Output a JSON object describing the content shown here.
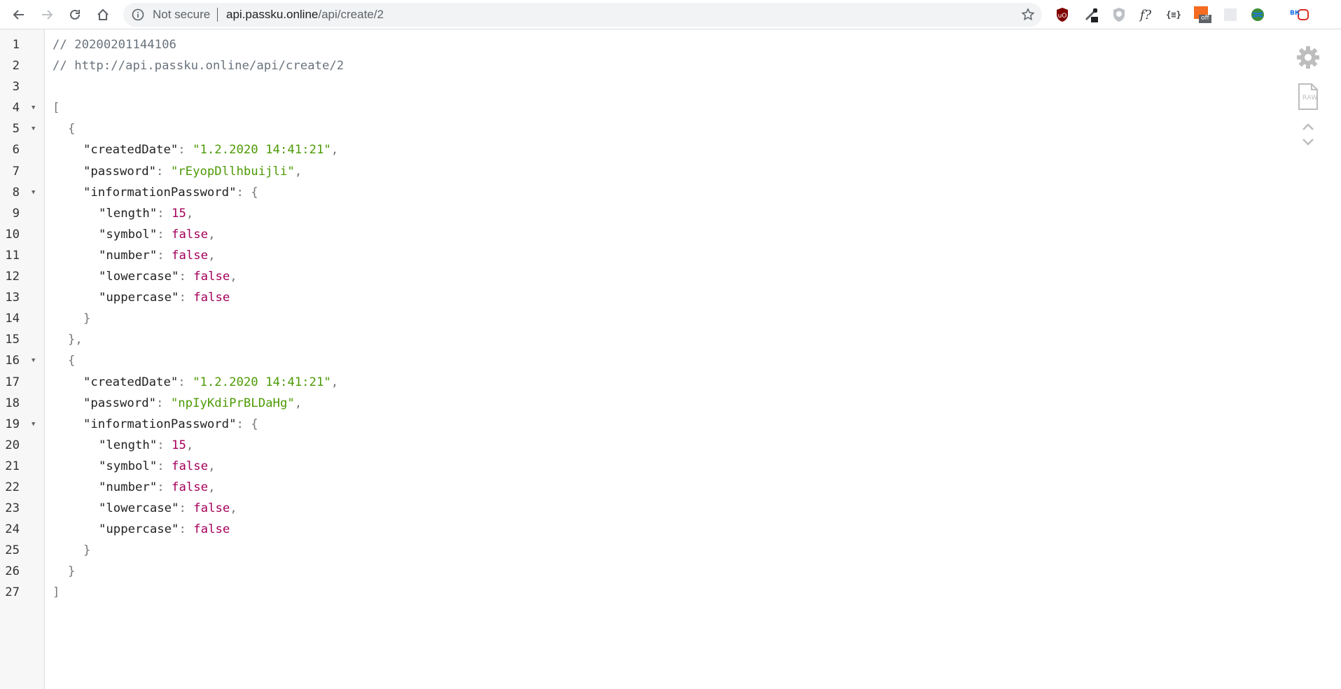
{
  "browser": {
    "security_label": "Not secure",
    "url_host": "api.passku.online",
    "url_path": "/api/create/2",
    "extensions": [
      {
        "name": "ublock-icon",
        "color": "#800000"
      },
      {
        "name": "eyedropper-icon",
        "color": "#202124"
      },
      {
        "name": "shield-icon",
        "color": "#9aa0a6"
      },
      {
        "name": "font-finder-icon",
        "label": "f?"
      },
      {
        "name": "json-viewer-icon",
        "label": "{≡}"
      },
      {
        "name": "off-extension-icon",
        "badge": "off",
        "color": "#f36c21"
      },
      {
        "name": "blank-extension-icon",
        "color": "#e8eaed"
      },
      {
        "name": "globe-extension-icon",
        "color": "#3b8e3a"
      },
      {
        "name": "vk-extension-icon",
        "label": "ВК"
      }
    ]
  },
  "json_view": {
    "header_comments": [
      "// 20200201144106",
      "// http://api.passku.online/api/create/2"
    ],
    "lines": [
      {
        "n": "1",
        "fold": false,
        "indent": 0,
        "tokens": [
          {
            "t": "comment",
            "v": "// 20200201144106"
          }
        ]
      },
      {
        "n": "2",
        "fold": false,
        "indent": 0,
        "tokens": [
          {
            "t": "comment",
            "v": "// http://api.passku.online/api/create/2"
          }
        ]
      },
      {
        "n": "3",
        "fold": false,
        "indent": 0,
        "tokens": []
      },
      {
        "n": "4",
        "fold": true,
        "indent": 0,
        "tokens": [
          {
            "t": "punc",
            "v": "["
          }
        ]
      },
      {
        "n": "5",
        "fold": true,
        "indent": 1,
        "tokens": [
          {
            "t": "punc",
            "v": "{"
          }
        ]
      },
      {
        "n": "6",
        "fold": false,
        "indent": 2,
        "tokens": [
          {
            "t": "key",
            "v": "\"createdDate\""
          },
          {
            "t": "punc",
            "v": ": "
          },
          {
            "t": "str",
            "v": "\"1.2.2020 14:41:21\""
          },
          {
            "t": "punc",
            "v": ","
          }
        ]
      },
      {
        "n": "7",
        "fold": false,
        "indent": 2,
        "tokens": [
          {
            "t": "key",
            "v": "\"password\""
          },
          {
            "t": "punc",
            "v": ": "
          },
          {
            "t": "str",
            "v": "\"rEyopDllhbuijli\""
          },
          {
            "t": "punc",
            "v": ","
          }
        ]
      },
      {
        "n": "8",
        "fold": true,
        "indent": 2,
        "tokens": [
          {
            "t": "key",
            "v": "\"informationPassword\""
          },
          {
            "t": "punc",
            "v": ": {"
          }
        ]
      },
      {
        "n": "9",
        "fold": false,
        "indent": 3,
        "tokens": [
          {
            "t": "key",
            "v": "\"length\""
          },
          {
            "t": "punc",
            "v": ": "
          },
          {
            "t": "num",
            "v": "15"
          },
          {
            "t": "punc",
            "v": ","
          }
        ]
      },
      {
        "n": "10",
        "fold": false,
        "indent": 3,
        "tokens": [
          {
            "t": "key",
            "v": "\"symbol\""
          },
          {
            "t": "punc",
            "v": ": "
          },
          {
            "t": "bool",
            "v": "false"
          },
          {
            "t": "punc",
            "v": ","
          }
        ]
      },
      {
        "n": "11",
        "fold": false,
        "indent": 3,
        "tokens": [
          {
            "t": "key",
            "v": "\"number\""
          },
          {
            "t": "punc",
            "v": ": "
          },
          {
            "t": "bool",
            "v": "false"
          },
          {
            "t": "punc",
            "v": ","
          }
        ]
      },
      {
        "n": "12",
        "fold": false,
        "indent": 3,
        "tokens": [
          {
            "t": "key",
            "v": "\"lowercase\""
          },
          {
            "t": "punc",
            "v": ": "
          },
          {
            "t": "bool",
            "v": "false"
          },
          {
            "t": "punc",
            "v": ","
          }
        ]
      },
      {
        "n": "13",
        "fold": false,
        "indent": 3,
        "tokens": [
          {
            "t": "key",
            "v": "\"uppercase\""
          },
          {
            "t": "punc",
            "v": ": "
          },
          {
            "t": "bool",
            "v": "false"
          }
        ]
      },
      {
        "n": "14",
        "fold": false,
        "indent": 2,
        "tokens": [
          {
            "t": "punc",
            "v": "}"
          }
        ]
      },
      {
        "n": "15",
        "fold": false,
        "indent": 1,
        "tokens": [
          {
            "t": "punc",
            "v": "},"
          }
        ]
      },
      {
        "n": "16",
        "fold": true,
        "indent": 1,
        "tokens": [
          {
            "t": "punc",
            "v": "{"
          }
        ]
      },
      {
        "n": "17",
        "fold": false,
        "indent": 2,
        "tokens": [
          {
            "t": "key",
            "v": "\"createdDate\""
          },
          {
            "t": "punc",
            "v": ": "
          },
          {
            "t": "str",
            "v": "\"1.2.2020 14:41:21\""
          },
          {
            "t": "punc",
            "v": ","
          }
        ]
      },
      {
        "n": "18",
        "fold": false,
        "indent": 2,
        "tokens": [
          {
            "t": "key",
            "v": "\"password\""
          },
          {
            "t": "punc",
            "v": ": "
          },
          {
            "t": "str",
            "v": "\"npIyKdiPrBLDaHg\""
          },
          {
            "t": "punc",
            "v": ","
          }
        ]
      },
      {
        "n": "19",
        "fold": true,
        "indent": 2,
        "tokens": [
          {
            "t": "key",
            "v": "\"informationPassword\""
          },
          {
            "t": "punc",
            "v": ": {"
          }
        ]
      },
      {
        "n": "20",
        "fold": false,
        "indent": 3,
        "tokens": [
          {
            "t": "key",
            "v": "\"length\""
          },
          {
            "t": "punc",
            "v": ": "
          },
          {
            "t": "num",
            "v": "15"
          },
          {
            "t": "punc",
            "v": ","
          }
        ]
      },
      {
        "n": "21",
        "fold": false,
        "indent": 3,
        "tokens": [
          {
            "t": "key",
            "v": "\"symbol\""
          },
          {
            "t": "punc",
            "v": ": "
          },
          {
            "t": "bool",
            "v": "false"
          },
          {
            "t": "punc",
            "v": ","
          }
        ]
      },
      {
        "n": "22",
        "fold": false,
        "indent": 3,
        "tokens": [
          {
            "t": "key",
            "v": "\"number\""
          },
          {
            "t": "punc",
            "v": ": "
          },
          {
            "t": "bool",
            "v": "false"
          },
          {
            "t": "punc",
            "v": ","
          }
        ]
      },
      {
        "n": "23",
        "fold": false,
        "indent": 3,
        "tokens": [
          {
            "t": "key",
            "v": "\"lowercase\""
          },
          {
            "t": "punc",
            "v": ": "
          },
          {
            "t": "bool",
            "v": "false"
          },
          {
            "t": "punc",
            "v": ","
          }
        ]
      },
      {
        "n": "24",
        "fold": false,
        "indent": 3,
        "tokens": [
          {
            "t": "key",
            "v": "\"uppercase\""
          },
          {
            "t": "punc",
            "v": ": "
          },
          {
            "t": "bool",
            "v": "false"
          }
        ]
      },
      {
        "n": "25",
        "fold": false,
        "indent": 2,
        "tokens": [
          {
            "t": "punc",
            "v": "}"
          }
        ]
      },
      {
        "n": "26",
        "fold": false,
        "indent": 1,
        "tokens": [
          {
            "t": "punc",
            "v": "}"
          }
        ]
      },
      {
        "n": "27",
        "fold": false,
        "indent": 0,
        "tokens": [
          {
            "t": "punc",
            "v": "]"
          }
        ]
      }
    ]
  },
  "side_controls": {
    "raw_label": "RAW"
  }
}
